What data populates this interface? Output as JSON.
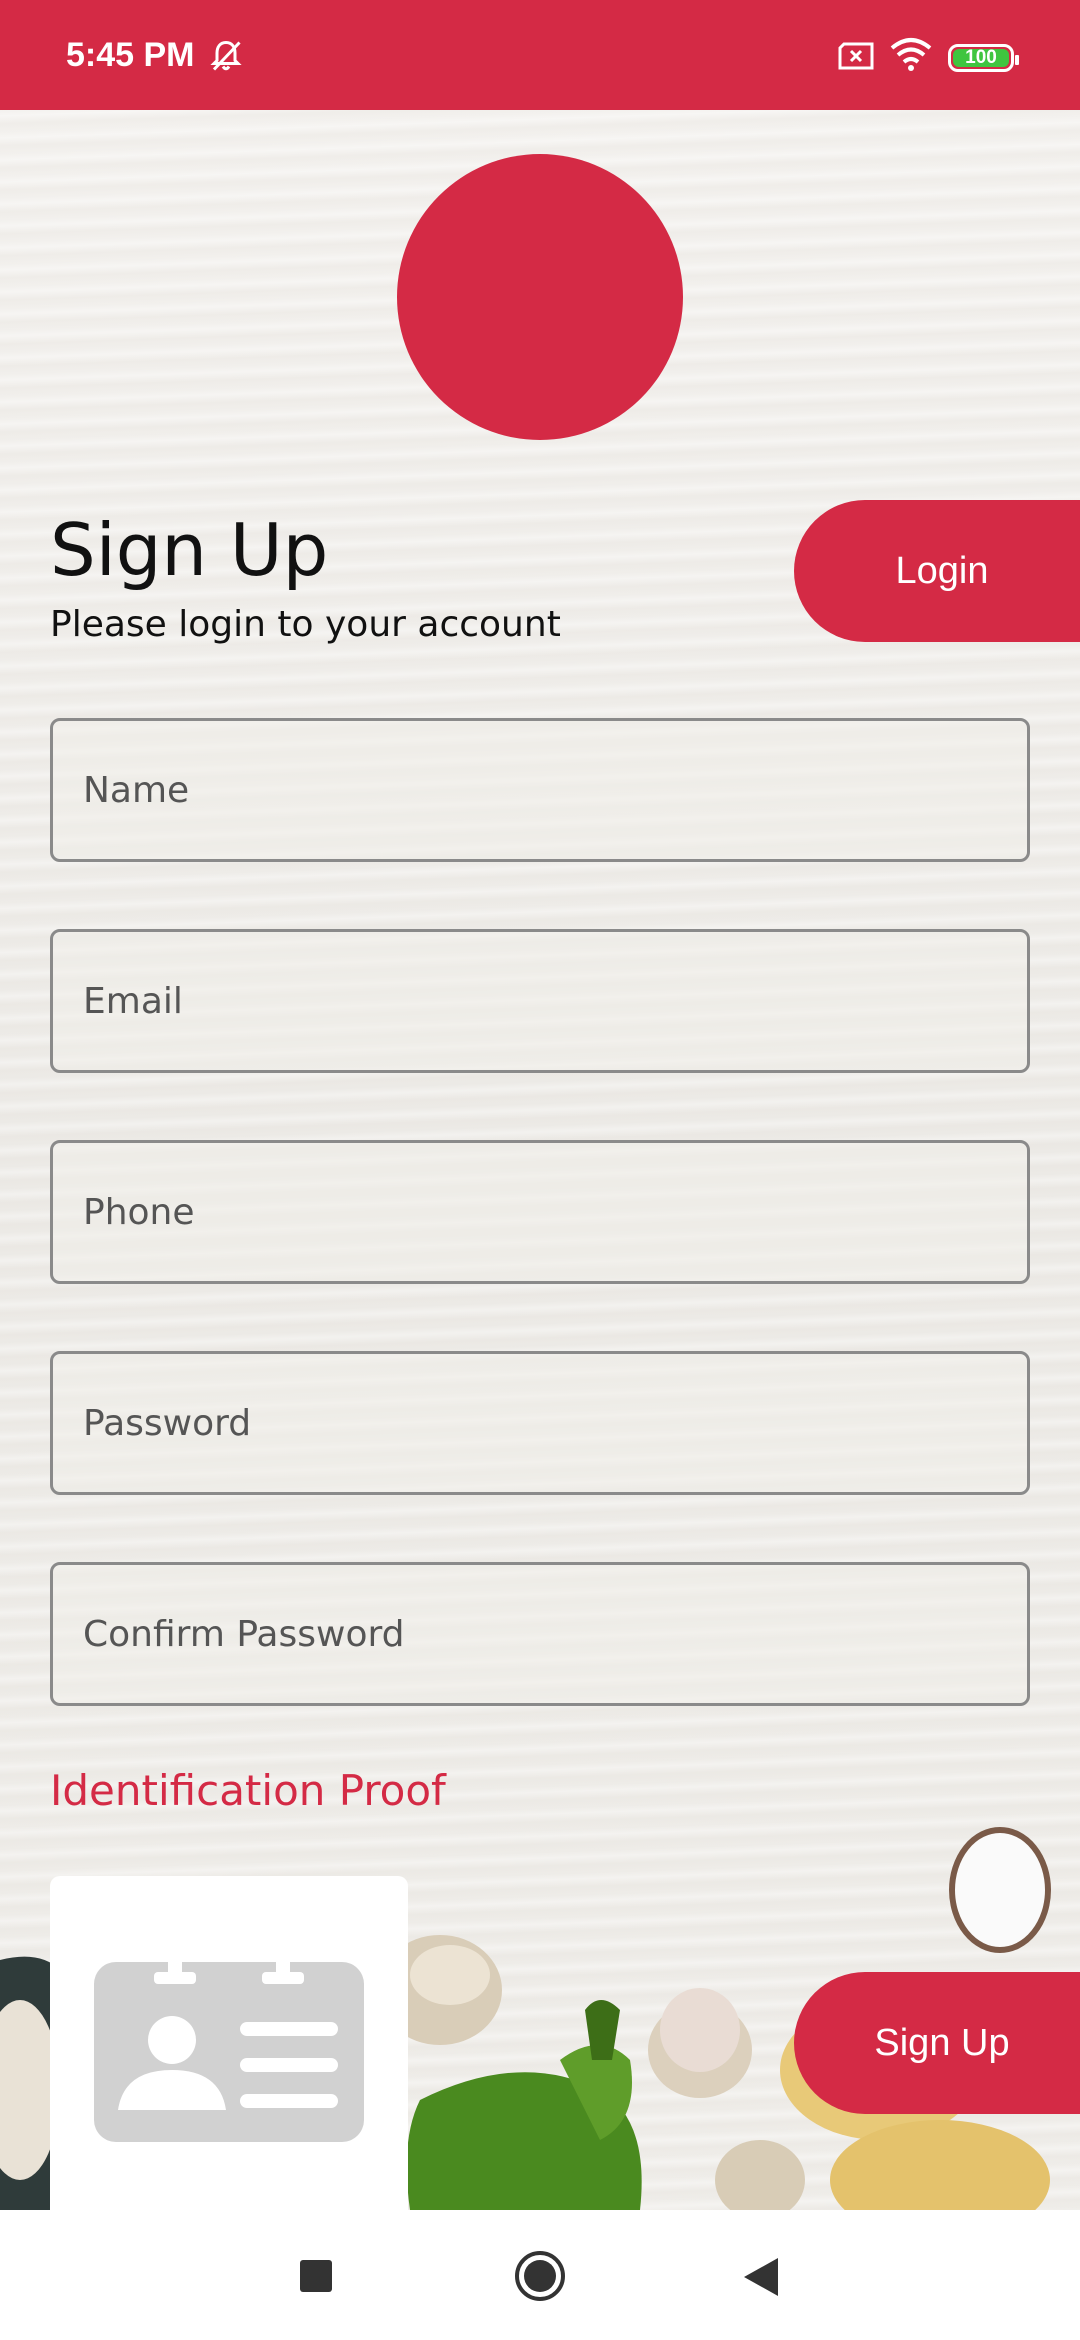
{
  "status_bar": {
    "time": "5:45 PM",
    "battery": "100",
    "colors": {
      "background": "#d42a45",
      "battery_fill": "#3fc53f"
    }
  },
  "header": {
    "title": "Sign Up",
    "subtitle": "Please login to your account",
    "login_label": "Login"
  },
  "form": {
    "name_placeholder": "Name",
    "email_placeholder": "Email",
    "phone_placeholder": "Phone",
    "password_placeholder": "Password",
    "confirm_password_placeholder": "Confirm Password",
    "id_proof_label": "Identification Proof",
    "signup_label": "Sign Up"
  },
  "icons": {
    "status": [
      "bell-off-icon",
      "sim-off-icon",
      "wifi-icon",
      "battery-icon"
    ],
    "upload": "id-card-icon",
    "nav": [
      "recents-square-icon",
      "home-circle-icon",
      "back-triangle-icon"
    ]
  },
  "colors": {
    "accent": "#d42a45",
    "text": "#111111",
    "field_border": "#8a8a8a"
  }
}
